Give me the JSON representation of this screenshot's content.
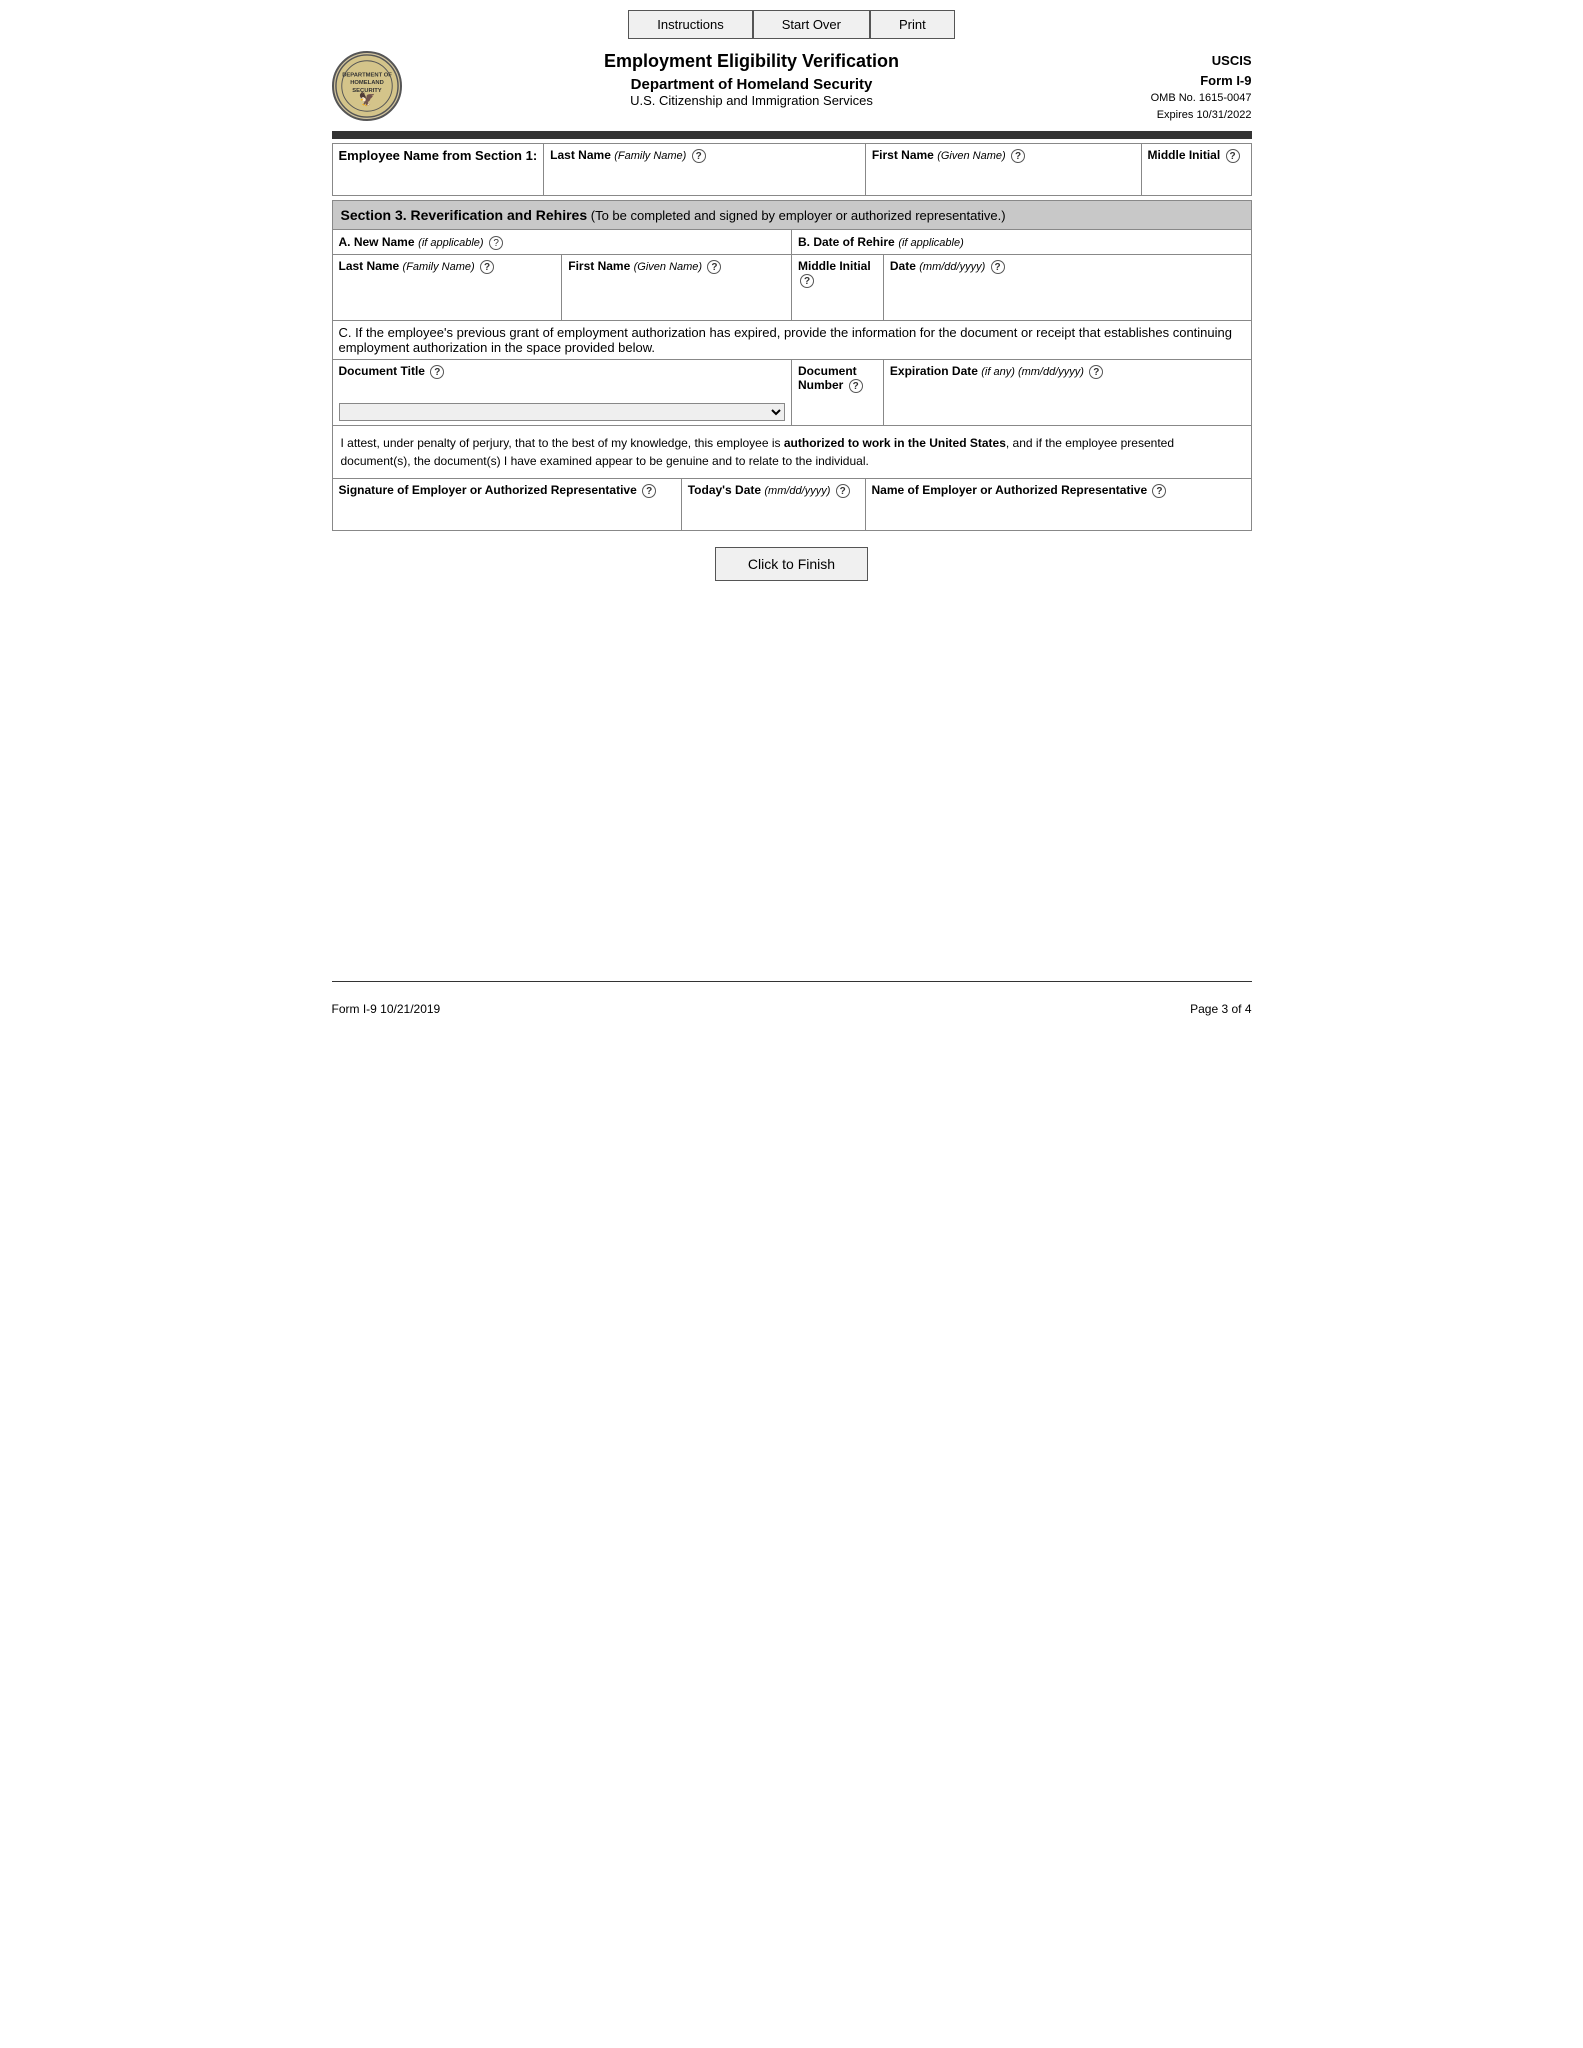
{
  "nav": {
    "instructions_label": "Instructions",
    "start_over_label": "Start Over",
    "print_label": "Print"
  },
  "header": {
    "title": "Employment Eligibility Verification",
    "dept": "Department of Homeland Security",
    "agency": "U.S. Citizenship and Immigration Services",
    "uscis": "USCIS",
    "form": "Form I-9",
    "omb": "OMB No. 1615-0047",
    "expires": "Expires 10/31/2022",
    "logo_text": "DEPT\nOF\nHOMELAND\nSECURITY"
  },
  "employee_name_row": {
    "label": "Employee Name from Section 1:",
    "last_name_label": "Last Name",
    "last_name_sublabel": "(Family Name)",
    "first_name_label": "First Name",
    "first_name_sublabel": "(Given Name)",
    "middle_initial_label": "Middle Initial"
  },
  "section3": {
    "title": "Section 3. Reverification and Rehires",
    "subtitle": "(To be completed and signed by employer or authorized representative.)",
    "new_name_label": "A. New Name",
    "new_name_sublabel": "(if applicable)",
    "date_rehire_label": "B. Date of Rehire",
    "date_rehire_sublabel": "(if applicable)",
    "last_name_label": "Last Name",
    "last_name_sublabel": "(Family Name)",
    "first_name_label": "First Name",
    "first_name_sublabel": "(Given Name)",
    "middle_initial_label": "Middle Initial",
    "date_label": "Date",
    "date_sublabel": "(mm/dd/yyyy)",
    "section_c_text": "C. If the employee's previous grant of employment authorization has expired, provide the information for the document or receipt that establishes continuing employment authorization in the space provided below.",
    "doc_title_label": "Document Title",
    "doc_number_label": "Document Number",
    "expiration_label": "Expiration Date",
    "expiration_sublabel": "(if any) (mm/dd/yyyy)",
    "attestation": "I attest, under penalty of perjury, that to the best of my knowledge, this employee is authorized to work in the United States, and if the employee presented document(s), the document(s) I have examined appear to be genuine and to relate to the individual.",
    "sig_label": "Signature of Employer or Authorized Representative",
    "today_date_label": "Today's Date",
    "today_date_sublabel": "(mm/dd/yyyy)",
    "employer_name_label": "Name of Employer or Authorized Representative"
  },
  "finish_button": "Click to Finish",
  "footer": {
    "left": "Form I-9  10/21/2019",
    "right": "Page 3 of 4"
  }
}
